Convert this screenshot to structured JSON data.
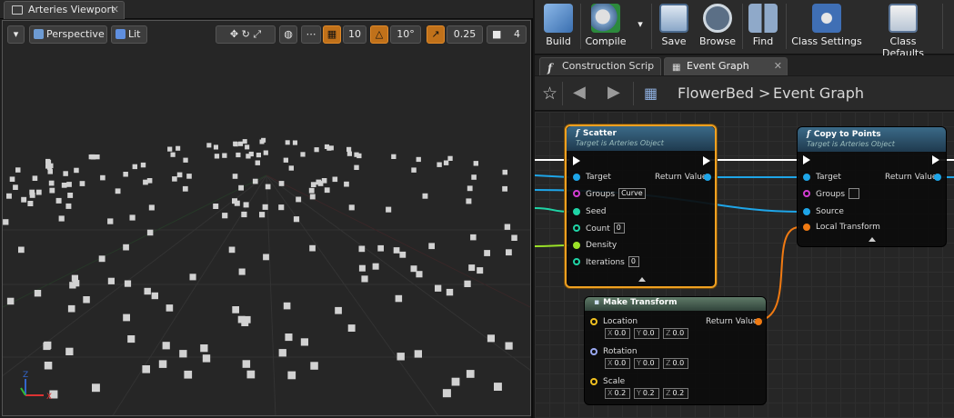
{
  "viewport": {
    "tab_label": "Arteries Viewport",
    "perspective_label": "Perspective",
    "lit_label": "Lit",
    "grid_snap": "10",
    "rotation_snap": "10°",
    "scale_snap": "0.25",
    "camera_speed": "4",
    "axis_x": "X",
    "axis_z": "Z"
  },
  "toolbar": {
    "build": "Build",
    "compile": "Compile",
    "save": "Save",
    "browse": "Browse",
    "find": "Find",
    "class_settings": "Class Settings",
    "class_defaults": "Class Defaults"
  },
  "tabs": {
    "construction": "Construction Scrip",
    "event_graph": "Event Graph"
  },
  "breadcrumb": {
    "blueprint": "FlowerBed",
    "separator": ">",
    "graph": "Event Graph"
  },
  "scatter_node": {
    "title": "Scatter",
    "subtitle": "Target is Arteries Object",
    "target": "Target",
    "groups": "Groups",
    "groups_value": "Curve",
    "seed": "Seed",
    "count": "Count",
    "count_value": "0",
    "density": "Density",
    "iterations": "Iterations",
    "iterations_value": "0",
    "return_value": "Return Value"
  },
  "copy_node": {
    "title": "Copy to Points",
    "subtitle": "Target is Arteries Object",
    "target": "Target",
    "groups": "Groups",
    "source": "Source",
    "local_transform": "Local Transform",
    "return_value": "Return Value"
  },
  "make_transform_node": {
    "title": "Make Transform",
    "location": "Location",
    "location_x": "0.0",
    "location_y": "0.0",
    "location_z": "0.0",
    "rotation": "Rotation",
    "rotation_x": "0.0",
    "rotation_y": "0.0",
    "rotation_z": "0.0",
    "scale": "Scale",
    "scale_x": "0.2",
    "scale_y": "0.2",
    "scale_z": "0.2",
    "return_value": "Return Value",
    "axis_x": "X",
    "axis_y": "Y",
    "axis_z": "Z"
  },
  "colors": {
    "object_pin": "#1ea5e8",
    "groups_pin": "#d23cd2",
    "int_pin": "#1fd4a6",
    "float_pin": "#9be228",
    "transform_pin": "#f07a12",
    "selection": "#f0a020"
  }
}
